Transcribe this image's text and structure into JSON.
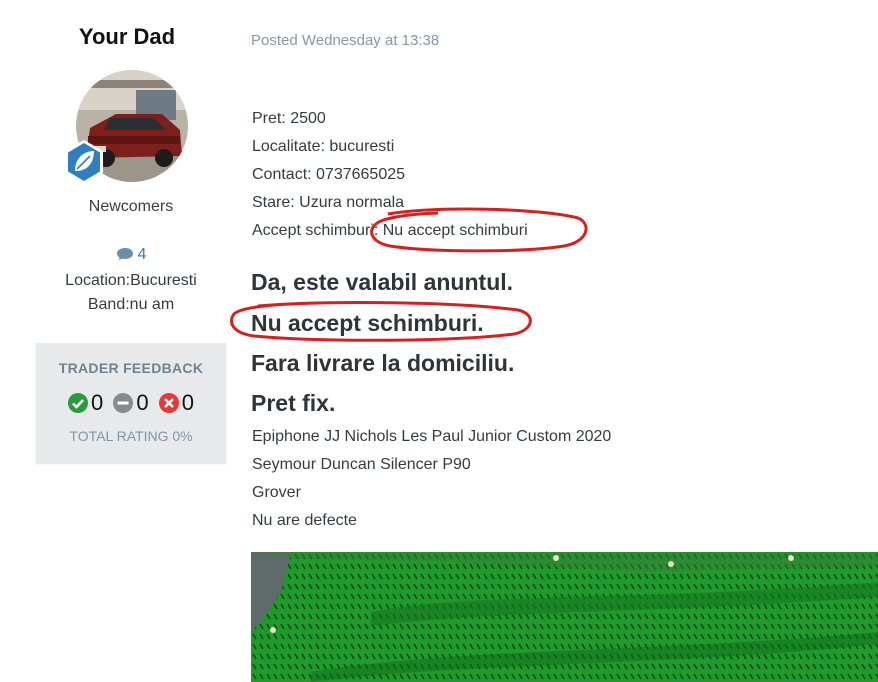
{
  "author": {
    "name": "Your Dad",
    "group": "Newcomers",
    "post_count": "4",
    "location": "Location:Bucuresti",
    "band": "Band:nu am"
  },
  "trader_feedback": {
    "title": "TRADER FEEDBACK",
    "positive": "0",
    "neutral": "0",
    "negative": "0",
    "total": "TOTAL RATING 0%"
  },
  "post": {
    "posted": "Posted Wednesday at 13:38",
    "details": [
      "Pret: 2500",
      "Localitate: bucuresti",
      "Contact: 0737665025",
      "Stare: Uzura normala",
      "Accept schimburi: Nu accept schimburi"
    ],
    "bold_lines": [
      "Da, este valabil anuntul.",
      "Nu accept schimburi.",
      "Fara livrare la domiciliu.",
      "Pret fix."
    ],
    "specs": [
      "Epiphone JJ Nichols Les Paul Junior Custom 2020",
      "Seymour Duncan Silencer P90",
      "Grover",
      "Nu are defecte"
    ]
  },
  "colors": {
    "positive": "#2a9a3a",
    "neutral": "#8a8a8a",
    "negative": "#e53935",
    "annotation": "#d62020",
    "badge": "#2f7fc0"
  }
}
